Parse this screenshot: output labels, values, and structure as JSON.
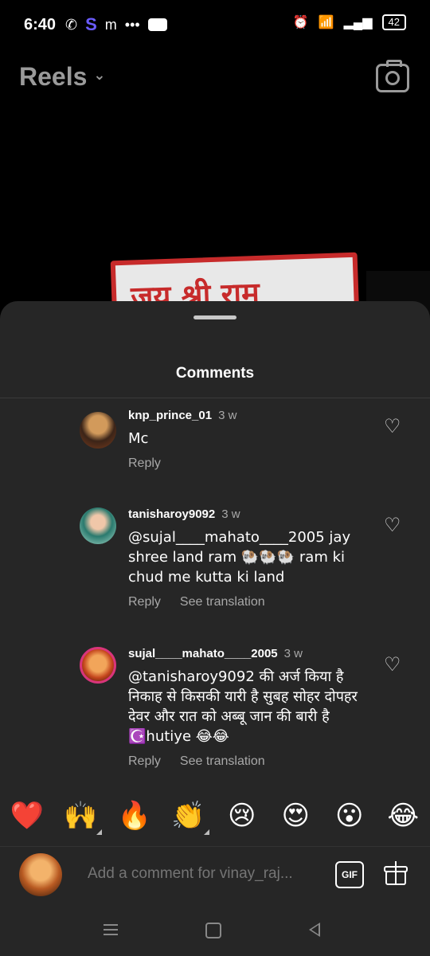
{
  "status_bar": {
    "time": "6:40",
    "app_s": "S",
    "app_m": "m",
    "dots": "•••",
    "battery": "42"
  },
  "header": {
    "title": "Reels",
    "chevron": "⌄",
    "camera_icon": "camera-icon"
  },
  "video": {
    "banner_text": "जय श्री राम"
  },
  "comments_sheet": {
    "title": "Comments",
    "comments": [
      {
        "username": "knp_prince_01",
        "time": "3 w",
        "text": "Mc",
        "reply": "Reply",
        "see_translation": ""
      },
      {
        "username": "tanisharoy9092",
        "time": "3 w",
        "text": "@sujal____mahato____2005 jay shree land ram 🐏🐏🐏 ram ki chud me kutta ki land",
        "reply": "Reply",
        "see_translation": "See translation"
      },
      {
        "username": "sujal____mahato____2005",
        "time": "3 w",
        "text": "@tanisharoy9092 की अर्ज किया है निकाह से किसकी यारी है सुबह सोहर दोपहर देवर और रात को अब्बू जान की बारी है ☪️hutiye 😂😂",
        "reply": "Reply",
        "see_translation": "See translation"
      }
    ]
  },
  "emoji_bar": [
    "❤️",
    "🙌",
    "🔥",
    "👏",
    "😢",
    "😍",
    "😮",
    "😂"
  ],
  "comment_input": {
    "placeholder": "Add a comment for vinay_raj...",
    "gif_label": "GIF"
  }
}
